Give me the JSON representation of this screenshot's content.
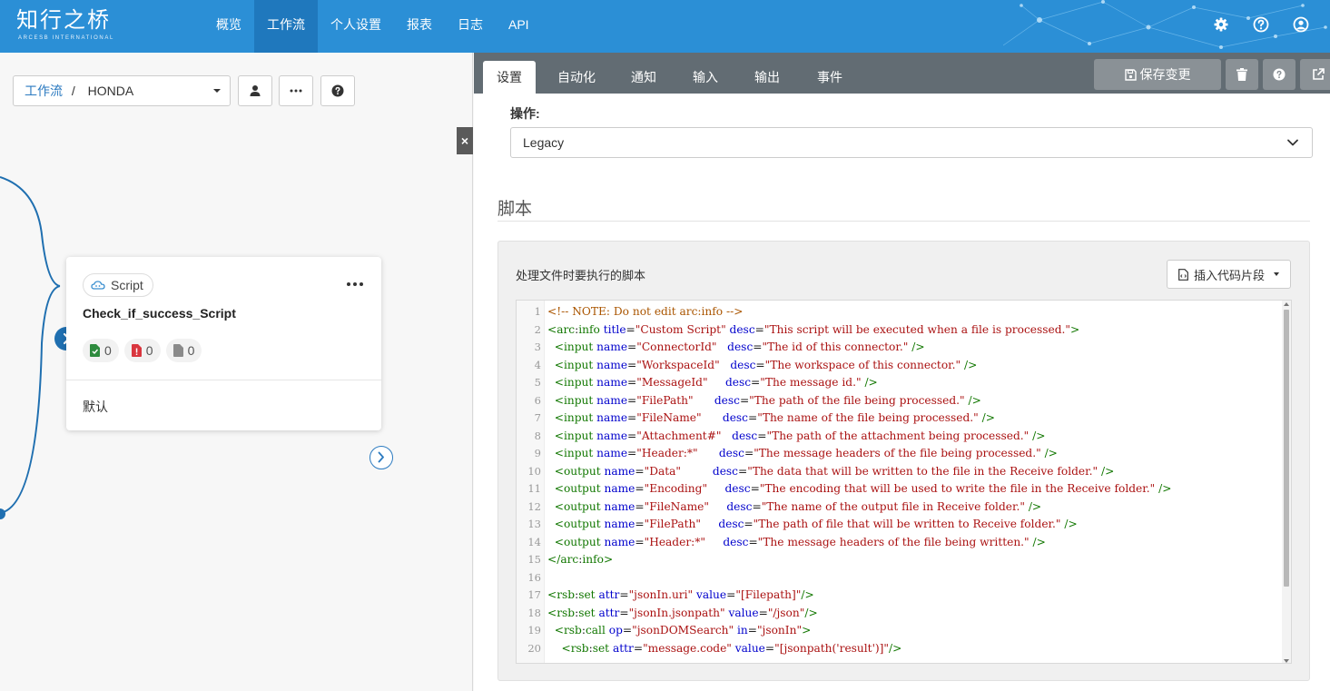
{
  "app": {
    "logo_cn": "知行之桥",
    "logo_en": "ARCESB INTERNATIONAL"
  },
  "nav": {
    "items": [
      {
        "label": "概览"
      },
      {
        "label": "工作流"
      },
      {
        "label": "个人设置"
      },
      {
        "label": "报表"
      },
      {
        "label": "日志"
      },
      {
        "label": "API"
      }
    ],
    "active_index": 1
  },
  "top_icons": [
    "gear-icon",
    "help-circle-icon",
    "user-icon"
  ],
  "breadcrumb": {
    "root": "工作流",
    "separator": "/",
    "current": "HONDA"
  },
  "left_toolbar": [
    "user-icon",
    "ellipsis-icon",
    "help-icon"
  ],
  "collapse_label": "×",
  "node_card": {
    "type_label": "Script",
    "title": "Check_if_success_Script",
    "counts": {
      "success": "0",
      "error": "0",
      "pending": "0"
    },
    "output_label": "默认"
  },
  "colors": {
    "topbar": "#2b8fd6",
    "nav_active": "#1f78bd",
    "tabbar": "#626c73",
    "link": "#2b7ac0",
    "success": "#2e8b3e",
    "error": "#d9363e"
  },
  "tabs": [
    {
      "label": "设置"
    },
    {
      "label": "自动化"
    },
    {
      "label": "通知"
    },
    {
      "label": "输入"
    },
    {
      "label": "输出"
    },
    {
      "label": "事件"
    }
  ],
  "toolbar": {
    "save_label": "保存变更"
  },
  "operation": {
    "label": "操作:",
    "value": "Legacy"
  },
  "script_section": {
    "title": "脚本",
    "description": "处理文件时要执行的脚本",
    "snippet_button": "插入代码片段"
  },
  "code_lines": [
    "<!-- NOTE: Do not edit arc:info -->",
    "<arc:info title=\"Custom Script\" desc=\"This script will be executed when a file is processed.\">",
    "  <input name=\"ConnectorId\"   desc=\"The id of this connector.\" />",
    "  <input name=\"WorkspaceId\"   desc=\"The workspace of this connector.\" />",
    "  <input name=\"MessageId\"     desc=\"The message id.\" />",
    "  <input name=\"FilePath\"      desc=\"The path of the file being processed.\" />",
    "  <input name=\"FileName\"      desc=\"The name of the file being processed.\" />",
    "  <input name=\"Attachment#\"   desc=\"The path of the attachment being processed.\" />",
    "  <input name=\"Header:*\"      desc=\"The message headers of the file being processed.\" />",
    "  <output name=\"Data\"         desc=\"The data that will be written to the file in the Receive folder.\" />",
    "  <output name=\"Encoding\"     desc=\"The encoding that will be used to write the file in the Receive folder.\" />",
    "  <output name=\"FileName\"     desc=\"The name of the output file in Receive folder.\" />",
    "  <output name=\"FilePath\"     desc=\"The path of file that will be written to Receive folder.\" />",
    "  <output name=\"Header:*\"     desc=\"The message headers of the file being written.\" />",
    "</arc:info>",
    "",
    "<rsb:set attr=\"jsonIn.uri\" value=\"[Filepath]\"/>",
    "<rsb:set attr=\"jsonIn.jsonpath\" value=\"/json\"/>",
    "  <rsb:call op=\"jsonDOMSearch\" in=\"jsonIn\">",
    "    <rsb:set attr=\"message.code\" value=\"[jsonpath('result')]\"/>"
  ]
}
